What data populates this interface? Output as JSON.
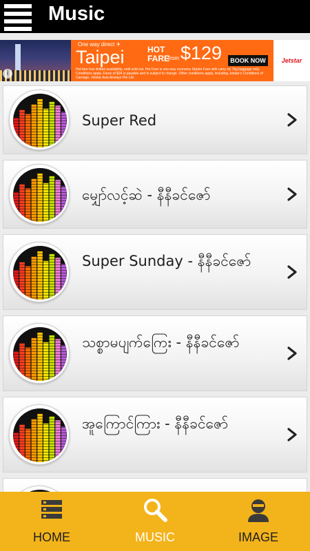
{
  "header": {
    "title": "Music"
  },
  "ad": {
    "tagline": "One way direct ✈",
    "city": "Taipei",
    "hot_fare": "HOT FARE",
    "from": "from",
    "price": "$129",
    "cta": "BOOK NOW",
    "brand": "Jetstar",
    "fine_print": "Hot fare has limited availability, until sold out. Hot Fare is one-way economy Starter Fare with carry-on 7kg baggage only. Conditions apply. Fares of $34 is payable and is subject to change. Other conditions apply, including Jetstar's Conditions of Carriage. Jetstar Asia Airways Pte Ltd."
  },
  "songs": [
    {
      "title": "Super Red"
    },
    {
      "title": "မျှော်လင့်ဆဲ - နီနီခင်ဇော်"
    },
    {
      "title": "Super Sunday - နီနီခင်ဇော်"
    },
    {
      "title": "သစ္စာမပျက်ကြေး - နီနီခင်ဇော်"
    },
    {
      "title": "အူကြောင်ကြား - နီနီခင်ဇော်"
    },
    {
      "title": ""
    }
  ],
  "nav": {
    "home": "HOME",
    "music": "MUSIC",
    "image": "IMAGE",
    "active": "music"
  },
  "colors": {
    "topbar": "#000000",
    "ad_background": "#ff6a13",
    "nav_background": "#f3b31a",
    "nav_active_label": "#ffffff"
  }
}
